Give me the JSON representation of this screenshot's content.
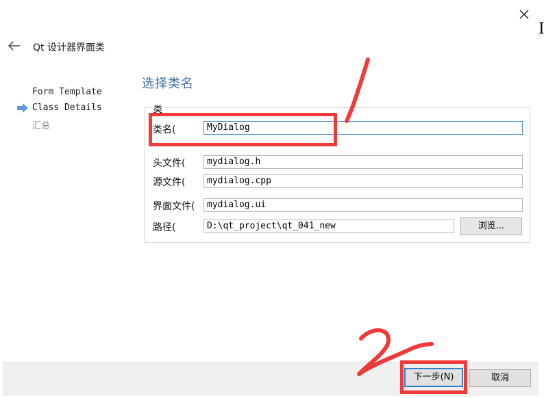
{
  "window": {
    "close_glyph": "×",
    "edge_glyph": "I"
  },
  "header": {
    "back_icon": "left-arrow-icon",
    "title": "Qt 设计器界面类"
  },
  "sidebar": {
    "current_icon": "right-arrow-icon",
    "steps": [
      {
        "label": "Form Template"
      },
      {
        "label": "Class Details"
      },
      {
        "label": "汇总"
      }
    ]
  },
  "main": {
    "heading": "选择类名",
    "group_title": "类",
    "fields": {
      "class_name": {
        "label": "类名(",
        "value": "MyDialog"
      },
      "header_file": {
        "label": "头文件(",
        "value": "mydialog.h"
      },
      "source_file": {
        "label": "源文件(",
        "value": "mydialog.cpp"
      },
      "form_file": {
        "label": "界面文件(",
        "value": "mydialog.ui"
      },
      "path": {
        "label": "路径(",
        "value": "D:\\qt_project\\qt_041_new"
      }
    },
    "browse_label": "浏览..."
  },
  "footer": {
    "next_label": "下一步(N)",
    "cancel_label": "取消"
  },
  "colors": {
    "accent": "#2f7fd6",
    "heading": "#3c6ea8",
    "annotation": "#f03a3a"
  }
}
